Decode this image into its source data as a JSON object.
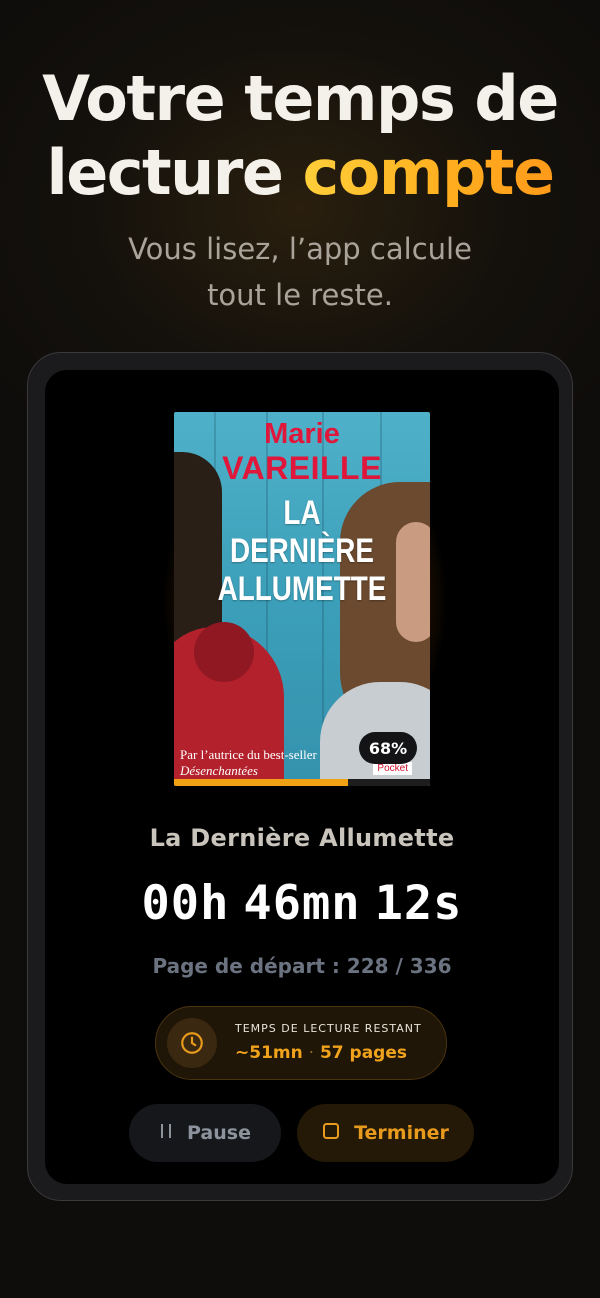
{
  "hero": {
    "title_line1": "Votre temps de",
    "title_line2_plain": "lecture",
    "title_line2_accent": "compte",
    "subtitle_line1": "Vous lisez, l’app calcule",
    "subtitle_line2": "tout le reste."
  },
  "book": {
    "cover_author_first": "Marie",
    "cover_author_last": "VAREILLE",
    "cover_title_line1": "LA",
    "cover_title_line2": "DERNIÈRE",
    "cover_title_line3": "ALLUMETTE",
    "cover_tagline_line1": "Par l’autrice du best-seller",
    "cover_tagline_line2": "Désenchantées",
    "cover_publisher": "Pocket",
    "progress_percent_label": "68%",
    "progress_fraction": 0.68,
    "title": "La Dernière Allumette"
  },
  "session": {
    "hours": "00h",
    "minutes": "46mn",
    "seconds": "12s",
    "start_page": "Page de départ : 228 / 336"
  },
  "remaining": {
    "icon": "clock-icon",
    "label": "TEMPS DE LECTURE RESTANT",
    "time": "~51mn",
    "separator": "·",
    "pages": "57 pages"
  },
  "actions": {
    "pause_label": "Pause",
    "pause_icon": "pause-icon",
    "finish_label": "Terminer",
    "finish_icon": "stop-square-icon"
  },
  "colors": {
    "accent": "#F5A623",
    "background": "#0F0D0B",
    "screen": "#000000"
  }
}
